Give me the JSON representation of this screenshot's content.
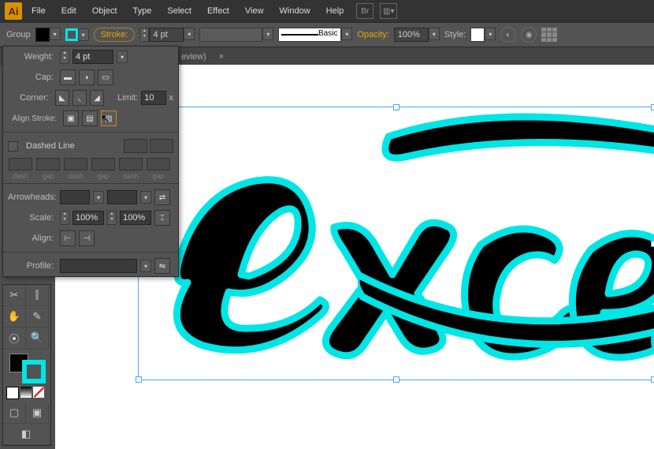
{
  "app": {
    "logo": "Ai"
  },
  "menu": {
    "file": "File",
    "edit": "Edit",
    "object": "Object",
    "type": "Type",
    "select": "Select",
    "effect": "Effect",
    "view": "View",
    "window": "Window",
    "help": "Help"
  },
  "ctrl": {
    "selection": "Group",
    "stroke_link": "Stroke:",
    "stroke_weight": "4 pt",
    "brush_label": "Basic",
    "opacity_label": "Opacity:",
    "opacity_value": "100%",
    "style_label": "Style:"
  },
  "tab": {
    "title": "eview)",
    "close": "×"
  },
  "strokePanel": {
    "weight_label": "Weight:",
    "weight_value": "4 pt",
    "cap_label": "Cap:",
    "corner_label": "Corner:",
    "limit_label": "Limit:",
    "limit_value": "10",
    "limit_x": "x",
    "align_label": "Align Stroke:",
    "dashed": "Dashed Line",
    "dash": "dash",
    "gap": "gap",
    "arrowheads": "Arrowheads:",
    "scale_label": "Scale:",
    "scale_value": "100%",
    "align2": "Align:",
    "profile": "Profile:"
  },
  "colors": {
    "accent": "#00e5e5",
    "fill": "#000000"
  }
}
